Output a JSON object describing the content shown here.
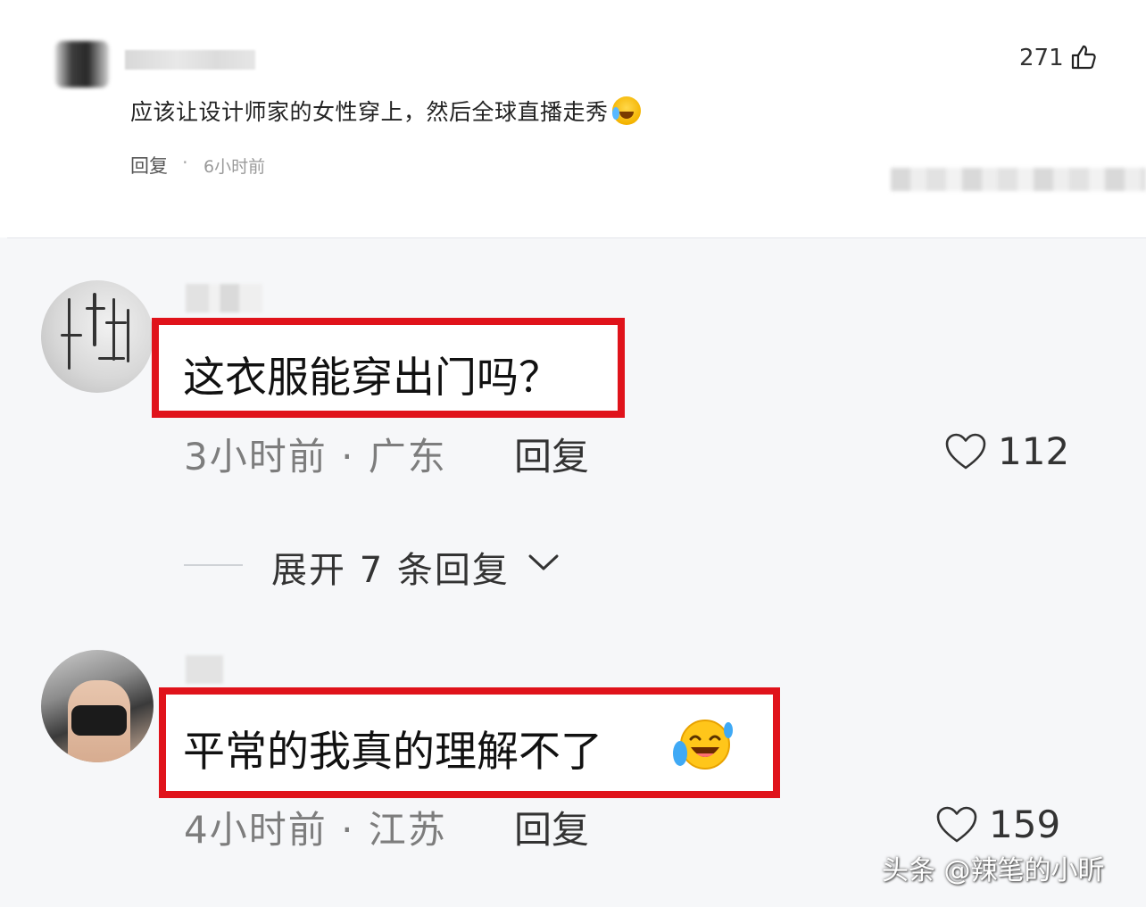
{
  "top_comment": {
    "text": "应该让设计师家的女性穿上，然后全球直播走秀",
    "reply_label": "回复",
    "separator": "·",
    "time": "6小时前",
    "like_count": "271"
  },
  "comments": [
    {
      "text": "这衣服能穿出门吗？",
      "meta": "3小时前 · 广东",
      "reply_label": "回复",
      "like_count": "112"
    },
    {
      "text": "平常的我真的理解不了",
      "meta": "4小时前 · 江苏",
      "reply_label": "回复",
      "like_count": "159"
    }
  ],
  "expand_replies": {
    "label": "展开 7 条回复"
  },
  "watermark": "头条 @辣笔的小昕",
  "colors": {
    "highlight": "#e0131b",
    "background": "#f6f7f9"
  },
  "icons": [
    "thumbs-up-icon",
    "heart-icon",
    "chevron-down-icon",
    "crying-laughing-emoji"
  ]
}
